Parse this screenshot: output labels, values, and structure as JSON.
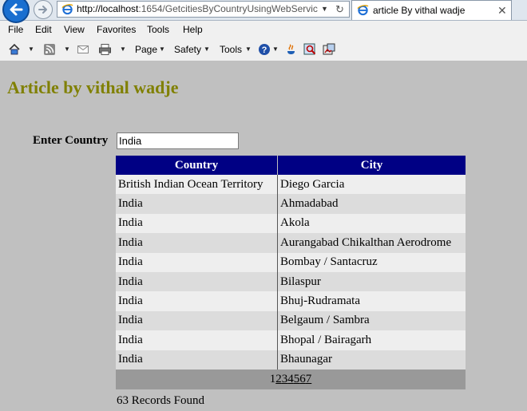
{
  "browser": {
    "url_host": "http://localhost",
    "url_rest": ":1654/GetcitiesByCountryUsingWebServic",
    "tab_title": "article By vithal wadje",
    "menu": [
      "File",
      "Edit",
      "View",
      "Favorites",
      "Tools",
      "Help"
    ],
    "command_bar": {
      "page_label": "Page",
      "safety_label": "Safety",
      "tools_label": "Tools"
    }
  },
  "page": {
    "title": "Article by vithal wadje",
    "country_label": "Enter Country",
    "country_value": "India"
  },
  "grid": {
    "columns": [
      "Country",
      "City"
    ],
    "rows": [
      {
        "country": "British Indian Ocean Territory",
        "city": "Diego Garcia"
      },
      {
        "country": "India",
        "city": "Ahmadabad"
      },
      {
        "country": "India",
        "city": "Akola"
      },
      {
        "country": "India",
        "city": "Aurangabad Chikalthan Aerodrome"
      },
      {
        "country": "India",
        "city": "Bombay / Santacruz"
      },
      {
        "country": "India",
        "city": "Bilaspur"
      },
      {
        "country": "India",
        "city": "Bhuj-Rudramata"
      },
      {
        "country": "India",
        "city": "Belgaum / Sambra"
      },
      {
        "country": "India",
        "city": "Bhopal / Bairagarh"
      },
      {
        "country": "India",
        "city": "Bhaunagar"
      }
    ],
    "pager": {
      "current": "1",
      "pages": [
        "2",
        "3",
        "4",
        "5",
        "6",
        "7"
      ]
    }
  },
  "records_text": "63 Records Found"
}
